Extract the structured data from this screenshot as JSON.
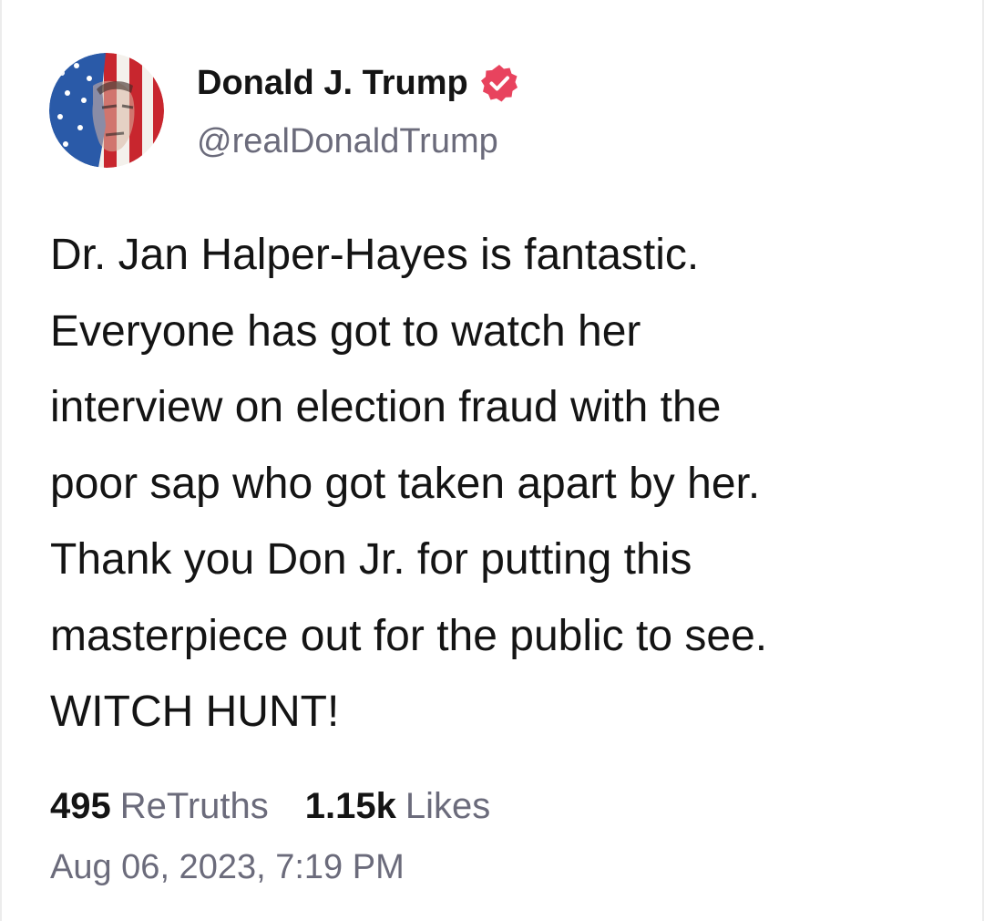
{
  "author": {
    "display_name": "Donald J. Trump",
    "handle": "@realDonaldTrump",
    "verified_icon": "verified-badge-icon",
    "verified_color": "#e8435e"
  },
  "post": {
    "lines": [
      "Dr. Jan Halper-Hayes is fantastic.",
      "Everyone has got to watch her",
      "interview on election fraud with the",
      "poor sap who got taken apart by her.",
      "Thank you Don Jr. for putting this",
      "masterpiece out for the public to see.",
      "WITCH HUNT!"
    ]
  },
  "stats": {
    "retruths_count": "495",
    "retruths_label": "ReTruths",
    "likes_count": "1.15k",
    "likes_label": "Likes"
  },
  "timestamp": "Aug 06, 2023, 7:19 PM",
  "colors": {
    "text": "#141414",
    "muted": "#6b6b7b",
    "background": "#ffffff"
  }
}
